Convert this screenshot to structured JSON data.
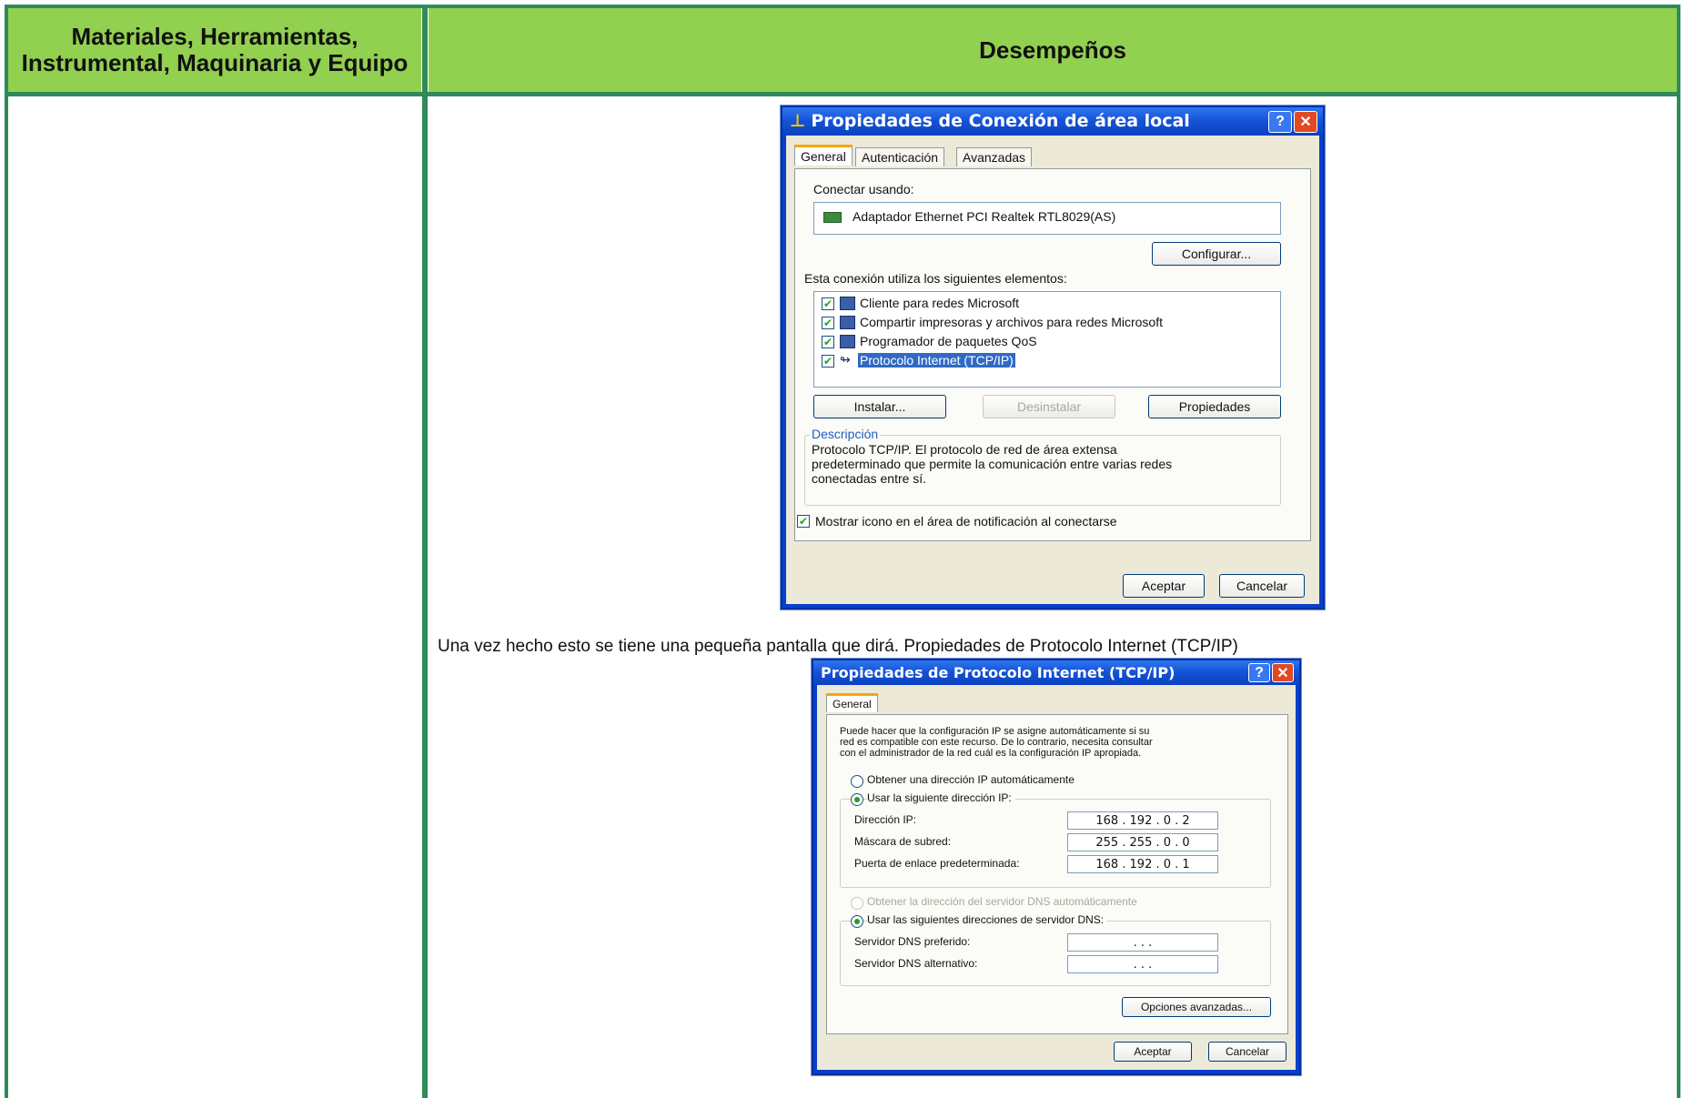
{
  "table": {
    "header_left": "Materiales, Herramientas, Instrumental, Maquinaria y Equipo",
    "header_right": "Desempeños",
    "caption": "Una vez hecho esto se tiene una pequeña pantalla que dirá. Propiedades de Protocolo Internet (TCP/IP)"
  },
  "dialog1": {
    "title": "Propiedades de Conexión de área local",
    "tabs": [
      "General",
      "Autenticación",
      "Avanzadas"
    ],
    "connect_using_label": "Conectar usando:",
    "adapter": "Adaptador Ethernet PCI Realtek RTL8029(AS)",
    "configure_button": "Configurar...",
    "elements_label": "Esta conexión utiliza los siguientes elementos:",
    "items": [
      {
        "label": "Cliente para redes Microsoft",
        "checked": true
      },
      {
        "label": "Compartir impresoras y archivos para redes Microsoft",
        "checked": true
      },
      {
        "label": "Programador de paquetes QoS",
        "checked": true
      },
      {
        "label": "Protocolo Internet (TCP/IP)",
        "checked": true,
        "selected": true
      }
    ],
    "install_button": "Instalar...",
    "uninstall_button": "Desinstalar",
    "properties_button": "Propiedades",
    "description_title": "Descripción",
    "description_line1": "Protocolo TCP/IP. El protocolo de red de área extensa",
    "description_line2": "predeterminado que permite la comunicación entre varias redes",
    "description_line3": "conectadas entre sí.",
    "show_icon_label": "Mostrar icono en el área de notificación al conectarse",
    "show_icon_checked": true,
    "accept_button": "Aceptar",
    "cancel_button": "Cancelar",
    "help_glyph": "?",
    "close_glyph": "✕"
  },
  "dialog2": {
    "title": "Propiedades de Protocolo Internet (TCP/IP)",
    "tab": "General",
    "intro_line1": "Puede hacer que la configuración IP se asigne automáticamente si su",
    "intro_line2": "red es compatible con este recurso. De lo contrario, necesita consultar",
    "intro_line3": "con el administrador de la red cuál es la configuración IP apropiada.",
    "auto_ip_label": "Obtener una dirección IP automáticamente",
    "manual_ip_label": "Usar la siguiente dirección IP:",
    "ip_label": "Dirección IP:",
    "ip_value": "168 . 192 .  0  .  2",
    "mask_label": "Máscara de subred:",
    "mask_value": "255 . 255 .  0  .  0",
    "gateway_label": "Puerta de enlace predeterminada:",
    "gateway_value": "168 . 192 .  0  .  1",
    "auto_dns_label": "Obtener la dirección del servidor DNS automáticamente",
    "manual_dns_label": "Usar las siguientes direcciones de servidor DNS:",
    "dns_pref_label": "Servidor DNS preferido:",
    "dns_pref_value": ".     .     .",
    "dns_alt_label": "Servidor DNS alternativo:",
    "dns_alt_value": ".     .     .",
    "advanced_button": "Opciones avanzadas...",
    "accept_button": "Aceptar",
    "cancel_button": "Cancelar",
    "help_glyph": "?",
    "close_glyph": "✕"
  }
}
